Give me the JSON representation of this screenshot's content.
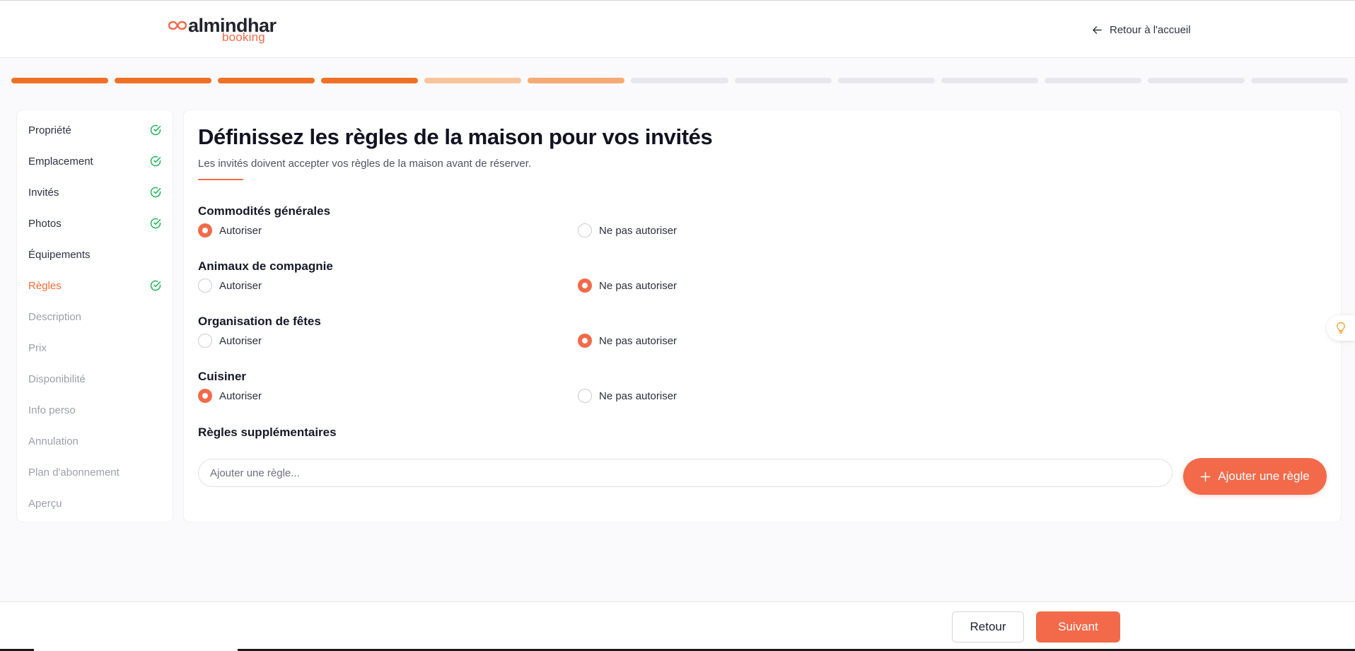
{
  "brand": {
    "name": "almindhar",
    "sub": "booking",
    "accent": "#f26a4a"
  },
  "header": {
    "back_home_label": "Retour à l'accueil",
    "back_icon": "arrow-left-icon"
  },
  "progress": {
    "total_steps": 13,
    "completed_steps": 4,
    "in_progress_steps": 2,
    "colors": {
      "done": "#f07125",
      "partial_light": "#f8c49b",
      "partial": "#f6aa73",
      "todo": "#e8e8ec"
    }
  },
  "sidebar": {
    "items": [
      {
        "label": "Propriété",
        "state": "done",
        "icon": "check-circle-icon"
      },
      {
        "label": "Emplacement",
        "state": "done",
        "icon": "check-circle-icon"
      },
      {
        "label": "Invités",
        "state": "done",
        "icon": "check-circle-icon"
      },
      {
        "label": "Photos",
        "state": "done",
        "icon": "check-circle-icon"
      },
      {
        "label": "Équipements",
        "state": "incomplete",
        "icon": ""
      },
      {
        "label": "Règles",
        "state": "active-done",
        "icon": "check-circle-icon"
      },
      {
        "label": "Description",
        "state": "pending",
        "icon": ""
      },
      {
        "label": "Prix",
        "state": "pending",
        "icon": ""
      },
      {
        "label": "Disponibilité",
        "state": "pending",
        "icon": ""
      },
      {
        "label": "Info perso",
        "state": "pending",
        "icon": ""
      },
      {
        "label": "Annulation",
        "state": "pending",
        "icon": ""
      },
      {
        "label": "Plan d'abonnement",
        "state": "pending",
        "icon": ""
      },
      {
        "label": "Aperçu",
        "state": "pending",
        "icon": ""
      }
    ]
  },
  "main": {
    "title": "Définissez les règles de la maison pour vos invités",
    "subtitle": "Les invités doivent accepter vos règles de la maison avant de réserver.",
    "allow_label": "Autoriser",
    "deny_label": "Ne pas autoriser",
    "rules": [
      {
        "label": "Commodités générales",
        "selected": "allow"
      },
      {
        "label": "Animaux de compagnie",
        "selected": "deny"
      },
      {
        "label": "Organisation de fêtes",
        "selected": "deny"
      },
      {
        "label": "Cuisiner",
        "selected": "allow"
      }
    ],
    "extra": {
      "label": "Règles supplémentaires",
      "placeholder": "Ajouter une règle...",
      "value": "",
      "add_label": "Ajouter une règle",
      "add_icon": "plus-icon"
    }
  },
  "tip": {
    "icon": "lightbulb-icon"
  },
  "footer": {
    "back_label": "Retour",
    "next_label": "Suivant"
  }
}
